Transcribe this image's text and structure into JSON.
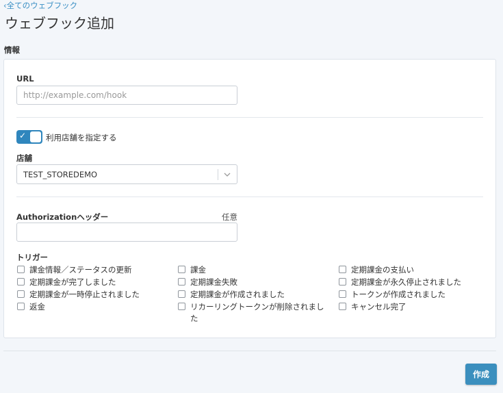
{
  "header": {
    "back_link": "‹全てのウェブフック",
    "title": "ウェブフック追加"
  },
  "section": {
    "label": "情報"
  },
  "form": {
    "url": {
      "label": "URL",
      "value": "",
      "placeholder": "http://example.com/hook"
    },
    "store_toggle": {
      "label": "利用店舗を指定する",
      "on": true
    },
    "store": {
      "label": "店舗",
      "selected": "TEST_STOREDEMO"
    },
    "authorization": {
      "label": "Authorizationヘッダー",
      "optional": "任意",
      "value": ""
    },
    "triggers": {
      "label": "トリガー",
      "items": [
        "課金情報／ステータスの更新",
        "課金",
        "定期課金の支払い",
        "定期課金が完了しました",
        "定期課金失敗",
        "定期課金が永久停止されました",
        "定期課金が一時停止されました",
        "定期課金が作成されました",
        "トークンが作成されました",
        "返金",
        "リカーリングトークンが削除されました",
        "キャンセル完了"
      ]
    }
  },
  "footer": {
    "create_label": "作成"
  },
  "colors": {
    "accent": "#2f86bd",
    "link": "#3a8fc4",
    "background": "#f3f6fa"
  }
}
